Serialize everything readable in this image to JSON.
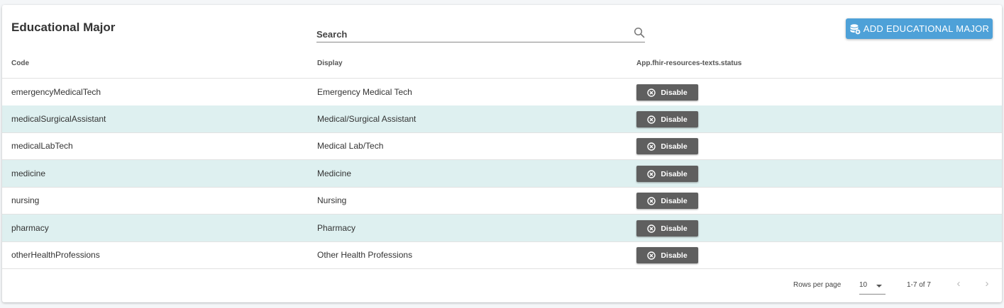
{
  "page": {
    "title": "Educational Major"
  },
  "search": {
    "placeholder": "Search",
    "value": ""
  },
  "actions": {
    "add_label": "ADD EDUCATIONAL MAJOR"
  },
  "table": {
    "headers": [
      "Code",
      "Display",
      "App.fhir-resources-texts.status"
    ],
    "rows": [
      {
        "code": "emergencyMedicalTech",
        "display": "Emergency Medical Tech",
        "status_action": "Disable"
      },
      {
        "code": "medicalSurgicalAssistant",
        "display": "Medical/Surgical Assistant",
        "status_action": "Disable"
      },
      {
        "code": "medicalLabTech",
        "display": "Medical Lab/Tech",
        "status_action": "Disable"
      },
      {
        "code": "medicine",
        "display": "Medicine",
        "status_action": "Disable"
      },
      {
        "code": "nursing",
        "display": "Nursing",
        "status_action": "Disable"
      },
      {
        "code": "pharmacy",
        "display": "Pharmacy",
        "status_action": "Disable"
      },
      {
        "code": "otherHealthProfessions",
        "display": "Other Health Professions",
        "status_action": "Disable"
      }
    ]
  },
  "pagination": {
    "rows_per_page_label": "Rows per page",
    "rows_per_page_value": "10",
    "range": "1-7 of 7"
  },
  "icons": {
    "search": "search-icon",
    "add": "database-add-icon",
    "disable": "circle-x-icon",
    "select": "caret-down-icon",
    "prev": "chevron-left-icon",
    "next": "chevron-right-icon"
  },
  "colors": {
    "accent": "#4ea1d8",
    "row_alt": "#def0f0",
    "disable_button": "#5f5f5f"
  }
}
